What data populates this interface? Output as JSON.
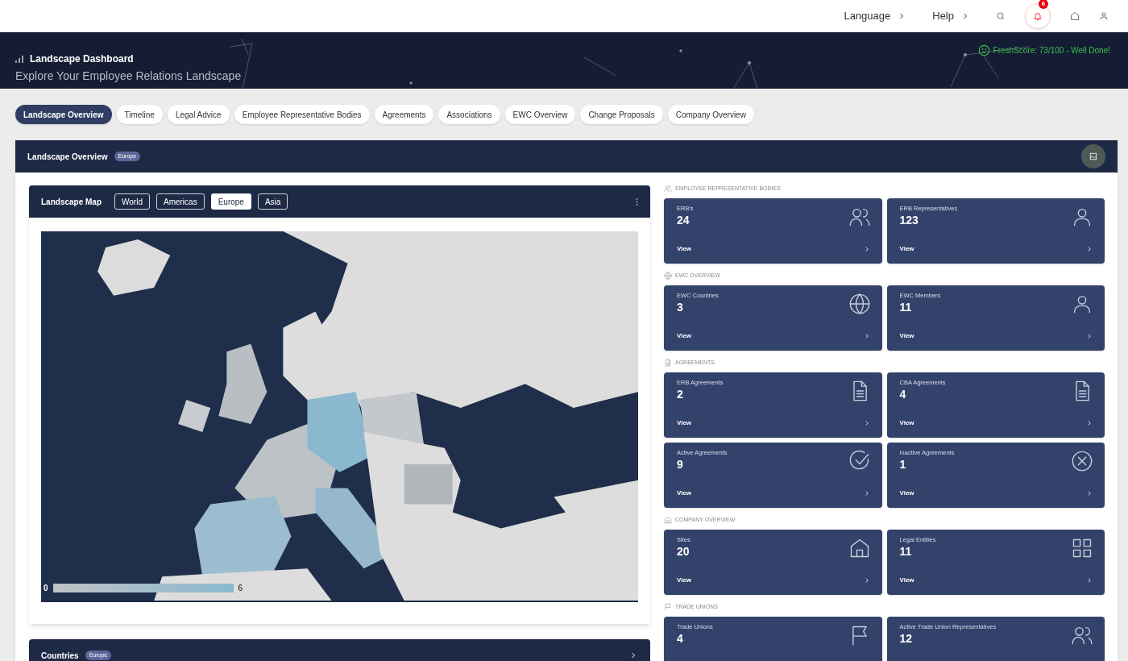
{
  "top_bar": {
    "menus": [
      {
        "label": "Language"
      },
      {
        "label": "Help"
      }
    ],
    "notification_count": "6"
  },
  "header": {
    "title": "Landscape Dashboard",
    "subtitle": "Explore Your Employee Relations Landscape",
    "score": "FreshScore: 73/100 - Well Done!"
  },
  "tabs": [
    {
      "label": "Landscape Overview",
      "selected": true
    },
    {
      "label": "Timeline",
      "selected": false
    },
    {
      "label": "Legal Advice",
      "selected": false
    },
    {
      "label": "Employee Representative Bodies",
      "selected": false
    },
    {
      "label": "Agreements",
      "selected": false
    },
    {
      "label": "Associations",
      "selected": false
    },
    {
      "label": "EWC Overview",
      "selected": false
    },
    {
      "label": "Change Proposals",
      "selected": false
    },
    {
      "label": "Company Overview",
      "selected": false
    }
  ],
  "panel": {
    "title": "Landscape Overview",
    "badge": "Europe"
  },
  "map_card": {
    "title": "Landscape Map",
    "regions": [
      {
        "label": "World",
        "selected": false
      },
      {
        "label": "Americas",
        "selected": false
      },
      {
        "label": "Europe",
        "selected": true
      },
      {
        "label": "Asia",
        "selected": false
      }
    ],
    "legend_min": "0",
    "legend_max": "6"
  },
  "countries_card": {
    "title": "Countries",
    "badge": "Europe"
  },
  "sections": [
    {
      "title": "EMPLOYEE REPRESENTATIVE BODIES",
      "kind": "users",
      "cards": [
        {
          "label": "ERB's",
          "value": "24",
          "kind": "users",
          "link": "View"
        },
        {
          "label": "ERB Representatives",
          "value": "123",
          "kind": "user",
          "link": "View"
        }
      ]
    },
    {
      "title": "EWC OVERVIEW",
      "kind": "globe",
      "cards": [
        {
          "label": "EWC Countries",
          "value": "3",
          "kind": "globe",
          "link": "View"
        },
        {
          "label": "EWC Members",
          "value": "11",
          "kind": "user",
          "link": "View"
        }
      ]
    },
    {
      "title": "AGREEMENTS",
      "kind": "document",
      "cards": [
        {
          "label": "ERB Agreements",
          "value": "2",
          "kind": "document",
          "link": "View"
        },
        {
          "label": "CBA Agreements",
          "value": "4",
          "kind": "document",
          "link": "View"
        },
        {
          "label": "Active Agreements",
          "value": "9",
          "kind": "check",
          "link": "View"
        },
        {
          "label": "Inactive Agreements",
          "value": "1",
          "kind": "cross",
          "link": "View"
        }
      ]
    },
    {
      "title": "COMPANY OVERVIEW",
      "kind": "home",
      "cards": [
        {
          "label": "Sites",
          "value": "20",
          "kind": "home",
          "link": "View"
        },
        {
          "label": "Legal Entities",
          "value": "11",
          "kind": "grid",
          "link": "View"
        }
      ]
    },
    {
      "title": "TRADE UNIONS",
      "kind": "flag",
      "cards": [
        {
          "label": "Trade Unions",
          "value": "4",
          "kind": "flag"
        },
        {
          "label": "Active Trade Union Representatives",
          "value": "12",
          "kind": "users"
        }
      ]
    }
  ]
}
